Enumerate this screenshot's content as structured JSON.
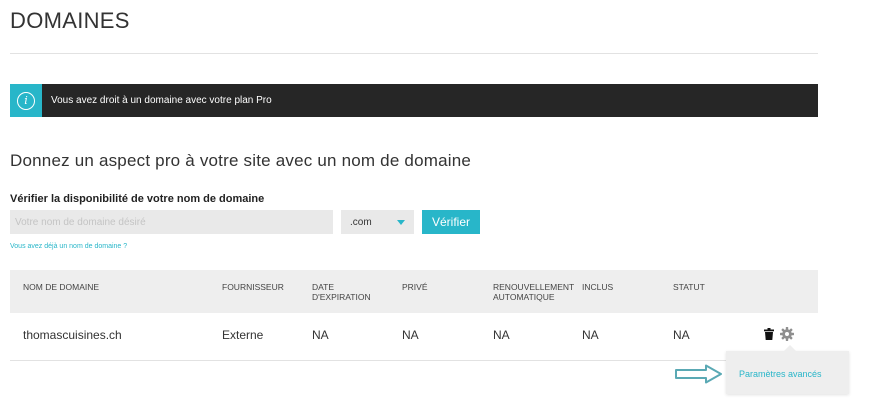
{
  "page": {
    "title": "DOMAINES"
  },
  "banner": {
    "message": "Vous avez droit à un domaine avec votre plan Pro",
    "icon": "info-icon",
    "icon_glyph": "i"
  },
  "promo": {
    "heading": "Donnez un aspect pro à votre site avec un nom de domaine"
  },
  "search": {
    "label": "Vérifier la disponibilité de votre nom de domaine",
    "placeholder": "Votre nom de domaine désiré",
    "tld": ".com",
    "verify_label": "Vérifier",
    "already_have_link": "Vous avez déjà un nom de domaine ?"
  },
  "table": {
    "headers": {
      "domain": [
        "",
        "NOM DE DOMAINE"
      ],
      "provider": [
        "",
        "FOURNISSEUR"
      ],
      "expiry": [
        "DATE",
        "D'EXPIRATION"
      ],
      "private": [
        "",
        "PRIVÉ"
      ],
      "renewal": [
        "RENOUVELLEMENT",
        "AUTOMATIQUE"
      ],
      "included": [
        "",
        "INCLUS"
      ],
      "status": [
        "",
        "STATUT"
      ]
    },
    "rows": [
      {
        "domain": "thomascuisines.ch",
        "provider": "Externe",
        "expiry": "NA",
        "private": "NA",
        "renewal": "NA",
        "included": "NA",
        "status": "NA"
      }
    ]
  },
  "actions_menu": {
    "items": [
      "Paramètres avancés"
    ]
  },
  "colors": {
    "accent": "#28b6c9",
    "banner_bg": "#262626",
    "header_bg": "#eeeeee"
  }
}
